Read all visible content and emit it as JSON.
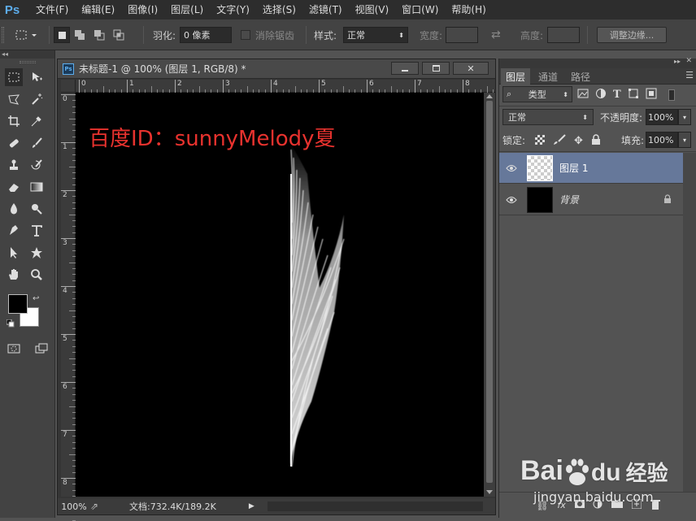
{
  "app": {
    "logo": "Ps"
  },
  "menu": [
    "文件(F)",
    "编辑(E)",
    "图像(I)",
    "图层(L)",
    "文字(Y)",
    "选择(S)",
    "滤镜(T)",
    "视图(V)",
    "窗口(W)",
    "帮助(H)"
  ],
  "options": {
    "feather_label": "羽化:",
    "feather_value": "0 像素",
    "antialias_label": "消除锯齿",
    "style_label": "样式:",
    "style_value": "正常",
    "width_label": "宽度:",
    "height_label": "高度:",
    "refine_edge_label": "调整边缘..."
  },
  "document": {
    "title": "未标题-1 @ 100% (图层 1, RGB/8) *",
    "zoom": "100%",
    "doc_info": "文档:732.4K/189.2K",
    "canvas_text": "百度ID：sunnyMelody夏",
    "h_ruler_ticks": [
      "0",
      "1",
      "2",
      "3",
      "4",
      "5",
      "6",
      "7",
      "8"
    ],
    "v_ruler_ticks": [
      "0",
      "1",
      "2",
      "3",
      "4",
      "5",
      "6",
      "7",
      "8"
    ]
  },
  "layers_panel": {
    "tabs": [
      "图层",
      "通道",
      "路径"
    ],
    "filter_label": "类型",
    "blend_mode": "正常",
    "opacity_label": "不透明度:",
    "opacity_value": "100%",
    "lock_label": "锁定:",
    "fill_label": "填充:",
    "fill_value": "100%",
    "layers": [
      {
        "name": "图层 1",
        "selected": true
      },
      {
        "name": "背景",
        "selected": false
      }
    ]
  },
  "watermark": {
    "brand": "Bai",
    "brand2": "du",
    "cn": "经验",
    "url": "jingyan.baidu.com"
  },
  "colors": {
    "canvas_text": "#e8322e",
    "selected_layer": "#66789a",
    "foreground": "#000000",
    "background": "#ffffff"
  }
}
